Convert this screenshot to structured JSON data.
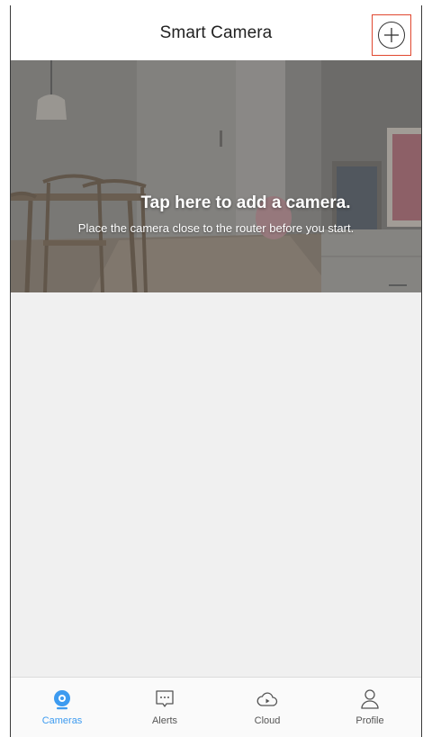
{
  "header": {
    "title": "Smart Camera",
    "add_icon": "plus-circle-icon"
  },
  "banner": {
    "title": "Tap here to add a camera.",
    "subtitle": "Place the camera close to the router before you start."
  },
  "tabs": [
    {
      "label": "Cameras",
      "icon": "camera-icon",
      "active": true
    },
    {
      "label": "Alerts",
      "icon": "chat-bubble-icon",
      "active": false
    },
    {
      "label": "Cloud",
      "icon": "cloud-play-icon",
      "active": false
    },
    {
      "label": "Profile",
      "icon": "person-icon",
      "active": false
    }
  ],
  "colors": {
    "accent": "#3d9bf0",
    "highlight_border": "#e0472f",
    "background": "#f0f0f0"
  }
}
